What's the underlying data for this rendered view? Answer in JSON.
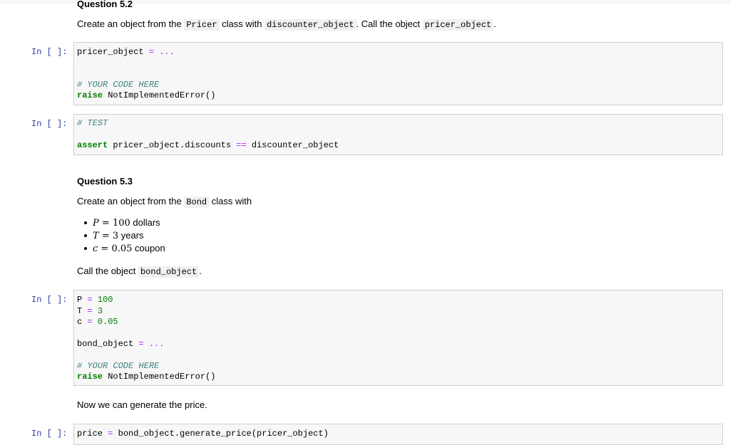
{
  "q52": {
    "title": "Question 5.2",
    "text1": "Create an object from the ",
    "code1": "Pricer",
    "text2": " class with ",
    "code2": "discounter_object",
    "text3": ". Call the object ",
    "code3": "pricer_object",
    "text4": "."
  },
  "cell1": {
    "prompt": "In [ ]:",
    "l1_var": "pricer_object",
    "l1_eq": "=",
    "l1_rest": "...",
    "l2_comment": "# YOUR CODE HERE",
    "l3_kw": "raise",
    "l3_rest": "NotImplementedError()"
  },
  "cell2": {
    "prompt": "In [ ]:",
    "l1_comment": "# TEST",
    "l2_kw": "assert",
    "l2_a": "pricer_object.discounts",
    "l2_op": "==",
    "l2_b": "discounter_object"
  },
  "q53": {
    "title": "Question 5.3",
    "text1": "Create an object from the ",
    "code1": "Bond",
    "text2": " class with",
    "bullets": [
      {
        "var": "P",
        "eq": "=",
        "val": "100",
        "unit": "dollars"
      },
      {
        "var": "T",
        "eq": "=",
        "val": "3",
        "unit": "years"
      },
      {
        "var": "c",
        "eq": "=",
        "val": "0.05",
        "unit": "coupon"
      }
    ],
    "call_text1": "Call the object ",
    "call_code": "bond_object",
    "call_text2": "."
  },
  "cell3": {
    "prompt": "In [ ]:",
    "p_var": "P",
    "p_eq": "=",
    "p_val": "100",
    "t_var": "T",
    "t_eq": "=",
    "t_val": "3",
    "c_var": "c",
    "c_eq": "=",
    "c_val": "0.05",
    "bond_var": "bond_object",
    "bond_eq": "=",
    "bond_rest": "...",
    "comment": "# YOUR CODE HERE",
    "raise_kw": "raise",
    "raise_rest": "NotImplementedError()"
  },
  "md_price": {
    "text": "Now we can generate the price."
  },
  "cell4": {
    "prompt": "In [ ]:",
    "var": "price",
    "eq": "=",
    "rest": "bond_object.generate_price(pricer_object)"
  }
}
